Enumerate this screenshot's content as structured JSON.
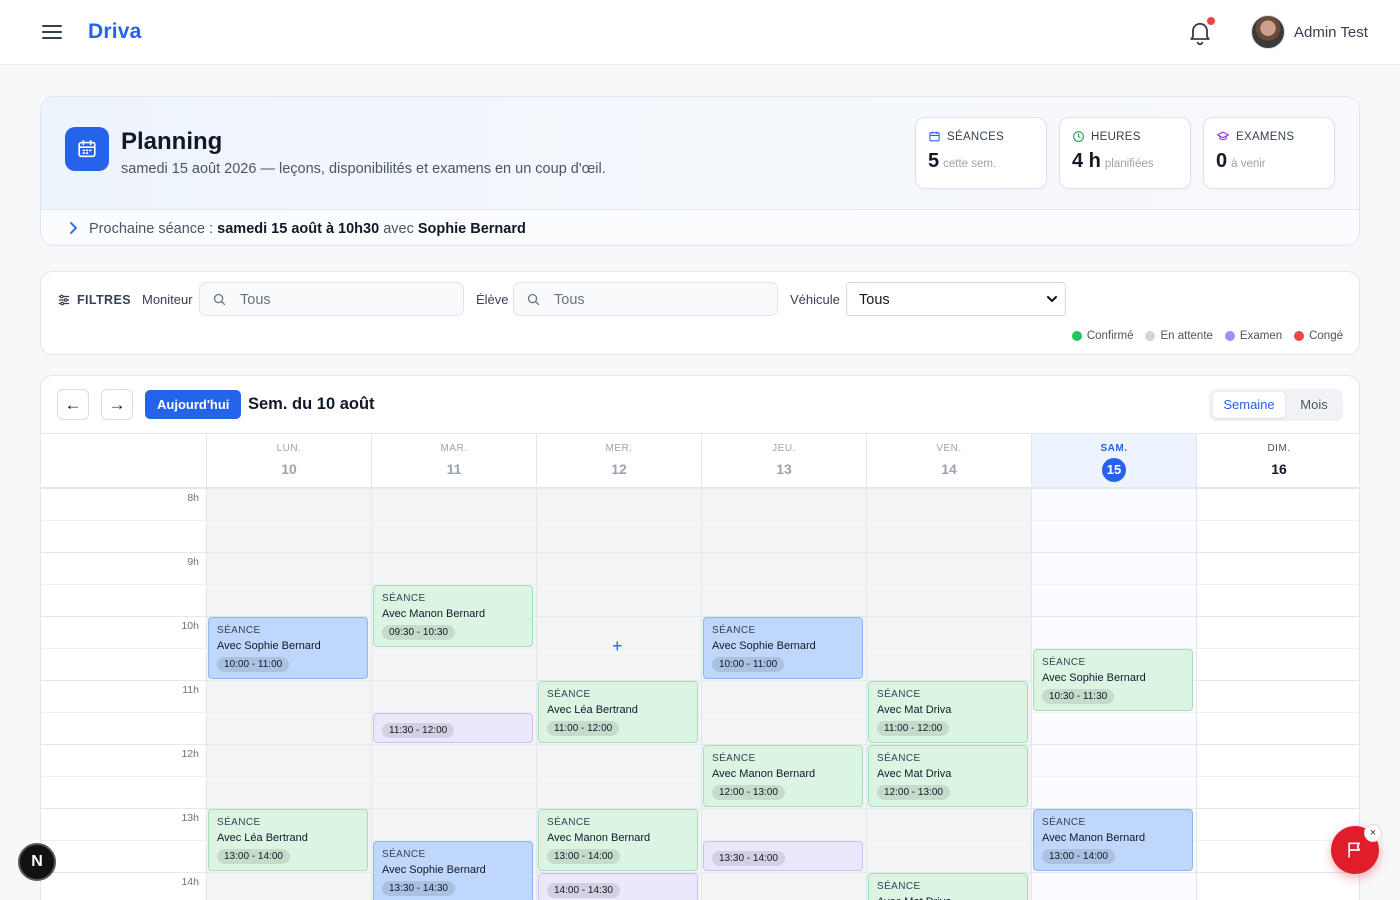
{
  "app": {
    "brand": "Driva",
    "user": "Admin Test",
    "has_notifications": true
  },
  "header": {
    "title": "Planning",
    "subtitle": "samedi 15 août 2026 — leçons, disponibilités et examens en un coup d'œil.",
    "stats": [
      {
        "label": "SÉANCES",
        "value": "5",
        "unit": "cette sem.",
        "icon": "calendar-icon"
      },
      {
        "label": "HEURES",
        "value": "4 h",
        "unit": "planifiées",
        "icon": "clock-icon"
      },
      {
        "label": "EXAMENS",
        "value": "0",
        "unit": "à venir",
        "icon": "graduation-cap-icon"
      }
    ],
    "next": {
      "prefix": "Prochaine séance : ",
      "when": "samedi 15 août à 10h30",
      "middle": " avec ",
      "who": "Sophie Bernard"
    }
  },
  "filters": {
    "title": "FILTRES",
    "moniteur_label": "Moniteur",
    "moniteur_placeholder": "Tous",
    "eleve_label": "Élève",
    "eleve_placeholder": "Tous",
    "vehicule_label": "Véhicule",
    "vehicule_value": "Tous",
    "legend": [
      {
        "label": "Confirmé",
        "color": "#22c55e"
      },
      {
        "label": "En attente",
        "color": "#d1d5db"
      },
      {
        "label": "Examen",
        "color": "#a78bfa"
      },
      {
        "label": "Congé",
        "color": "#ef4444"
      }
    ]
  },
  "calendar": {
    "today_label": "Aujourd'hui",
    "week_title": "Sem. du 10 août",
    "views": [
      "Semaine",
      "Mois"
    ],
    "days": [
      {
        "name": "LUN.",
        "num": "10"
      },
      {
        "name": "MAR.",
        "num": "11"
      },
      {
        "name": "MER.",
        "num": "12"
      },
      {
        "name": "JEU.",
        "num": "13"
      },
      {
        "name": "VEN.",
        "num": "14"
      },
      {
        "name": "SAM.",
        "num": "15"
      },
      {
        "name": "DIM.",
        "num": "16"
      }
    ],
    "hours": [
      "8h",
      "9h",
      "10h",
      "11h",
      "12h",
      "13h",
      "14h"
    ],
    "event_type_label": "SÉANCE",
    "events": [
      {
        "day": 0,
        "start": "10:00",
        "end": "11:00",
        "kind": "seance",
        "status": "blue",
        "name": "Avec Sophie Bernard",
        "time": "10:00 - 11:00"
      },
      {
        "day": 0,
        "start": "13:00",
        "end": "14:00",
        "kind": "seance",
        "status": "green",
        "name": "Avec Léa Bertrand",
        "time": "13:00 - 14:00"
      },
      {
        "day": 1,
        "start": "09:30",
        "end": "10:30",
        "kind": "seance",
        "status": "green",
        "name": "Avec Manon Bernard",
        "time": "09:30 - 10:30"
      },
      {
        "day": 1,
        "start": "11:30",
        "end": "12:00",
        "kind": "slot",
        "status": "purple",
        "name": "",
        "time": "11:30 - 12:00"
      },
      {
        "day": 1,
        "start": "13:30",
        "end": "14:30",
        "kind": "seance",
        "status": "blue",
        "name": "Avec Sophie Bernard",
        "time": "13:30 - 14:30"
      },
      {
        "day": 2,
        "start": "11:00",
        "end": "12:00",
        "kind": "seance",
        "status": "green",
        "name": "Avec Léa Bertrand",
        "time": "11:00 - 12:00"
      },
      {
        "day": 2,
        "start": "13:00",
        "end": "14:00",
        "kind": "seance",
        "status": "green",
        "name": "Avec Manon Bernard",
        "time": "13:00 - 14:00"
      },
      {
        "day": 2,
        "start": "14:00",
        "end": "14:30",
        "kind": "slot",
        "status": "purple",
        "name": "",
        "time": "14:00 - 14:30"
      },
      {
        "day": 3,
        "start": "10:00",
        "end": "11:00",
        "kind": "seance",
        "status": "blue",
        "name": "Avec Sophie Bernard",
        "time": "10:00 - 11:00"
      },
      {
        "day": 3,
        "start": "12:00",
        "end": "13:00",
        "kind": "seance",
        "status": "green",
        "name": "Avec Manon Bernard",
        "time": "12:00 - 13:00"
      },
      {
        "day": 3,
        "start": "13:30",
        "end": "14:00",
        "kind": "slot",
        "status": "purple",
        "name": "",
        "time": "13:30 - 14:00"
      },
      {
        "day": 4,
        "start": "11:00",
        "end": "12:00",
        "kind": "seance",
        "status": "green",
        "name": "Avec Mat Driva",
        "time": "11:00 - 12:00"
      },
      {
        "day": 4,
        "start": "12:00",
        "end": "13:00",
        "kind": "seance",
        "status": "green",
        "name": "Avec Mat Driva",
        "time": "12:00 - 13:00"
      },
      {
        "day": 4,
        "start": "14:00",
        "end": "15:00",
        "kind": "seance",
        "status": "green",
        "name": "Avec Mat Driva",
        "time": ""
      },
      {
        "day": 5,
        "start": "10:30",
        "end": "11:30",
        "kind": "seance",
        "status": "green",
        "name": "Avec Sophie Bernard",
        "time": "10:30 - 11:30"
      },
      {
        "day": 5,
        "start": "13:00",
        "end": "14:00",
        "kind": "seance",
        "status": "blue",
        "name": "Avec Manon Bernard",
        "time": "13:00 - 14:00"
      }
    ],
    "add_marker": {
      "day": 2,
      "at": "10:30",
      "symbol": "+"
    }
  },
  "floating": {
    "n_badge": "N",
    "fab_close": "×"
  },
  "colors": {
    "accent": "#2563eb",
    "confirmed": "#22c55e",
    "pending": "#d1d5db",
    "exam": "#a78bfa",
    "leave": "#ef4444"
  }
}
